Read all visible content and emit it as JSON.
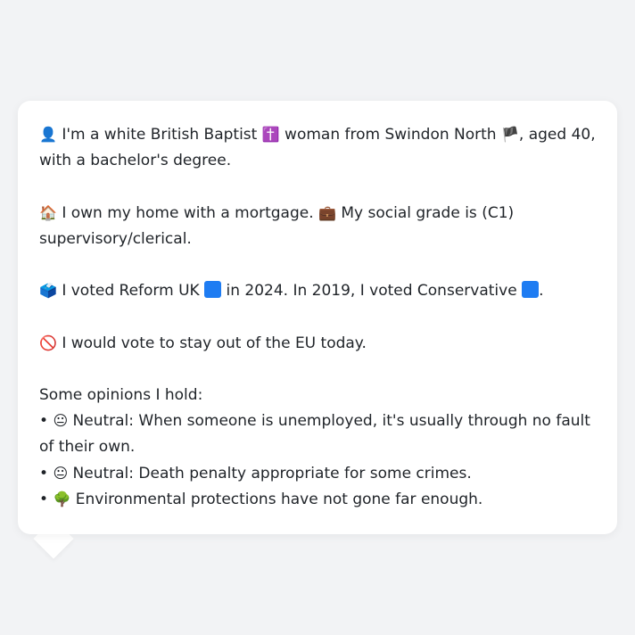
{
  "card": {
    "identity": {
      "icon": "👤",
      "text_a": " I'm a white British Baptist ",
      "cross": "✝️",
      "text_b": " woman from Swindon North ",
      "flag": "🏴",
      "text_c": ", aged 40, with a bachelor's degree."
    },
    "home": {
      "icon": "🏠",
      "text_a": " I own my home with a mortgage. ",
      "briefcase": "💼",
      "text_b": " My social grade is (C1) supervisory/clerical."
    },
    "vote": {
      "icon": "🗳️",
      "text_a": " I voted Reform UK ",
      "text_b": " in 2024. In 2019, I voted Conservative ",
      "text_c": ".",
      "reform_color": "#1e7cf2",
      "conservative_color": "#1e7cf2"
    },
    "eu": {
      "icon": "🚫",
      "text": " I would vote to stay out of the EU today."
    },
    "opinions": {
      "heading": "Some opinions I hold:",
      "items": [
        {
          "bullet": "•",
          "icon": "😐",
          "text": " Neutral: When someone is unemployed, it's usually through no fault of their own."
        },
        {
          "bullet": "•",
          "icon": "😐",
          "text": " Neutral: Death penalty appropriate for some crimes."
        },
        {
          "bullet": "•",
          "icon": "🌳",
          "text": " Environmental protections have not gone far enough."
        }
      ]
    }
  }
}
